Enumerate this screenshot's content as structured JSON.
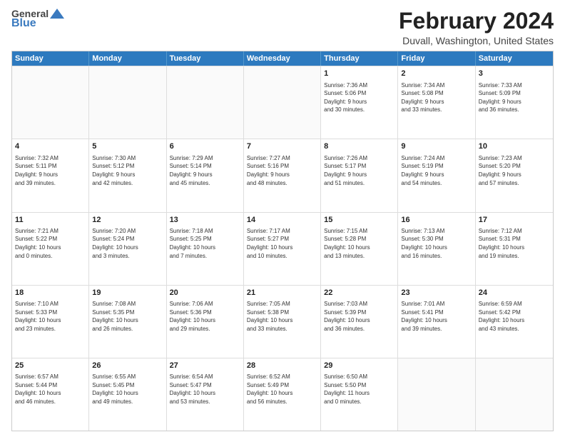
{
  "logo": {
    "general": "General",
    "blue": "Blue"
  },
  "title": "February 2024",
  "location": "Duvall, Washington, United States",
  "days": [
    "Sunday",
    "Monday",
    "Tuesday",
    "Wednesday",
    "Thursday",
    "Friday",
    "Saturday"
  ],
  "rows": [
    [
      {
        "day": "",
        "info": ""
      },
      {
        "day": "",
        "info": ""
      },
      {
        "day": "",
        "info": ""
      },
      {
        "day": "",
        "info": ""
      },
      {
        "day": "1",
        "info": "Sunrise: 7:36 AM\nSunset: 5:06 PM\nDaylight: 9 hours\nand 30 minutes."
      },
      {
        "day": "2",
        "info": "Sunrise: 7:34 AM\nSunset: 5:08 PM\nDaylight: 9 hours\nand 33 minutes."
      },
      {
        "day": "3",
        "info": "Sunrise: 7:33 AM\nSunset: 5:09 PM\nDaylight: 9 hours\nand 36 minutes."
      }
    ],
    [
      {
        "day": "4",
        "info": "Sunrise: 7:32 AM\nSunset: 5:11 PM\nDaylight: 9 hours\nand 39 minutes."
      },
      {
        "day": "5",
        "info": "Sunrise: 7:30 AM\nSunset: 5:12 PM\nDaylight: 9 hours\nand 42 minutes."
      },
      {
        "day": "6",
        "info": "Sunrise: 7:29 AM\nSunset: 5:14 PM\nDaylight: 9 hours\nand 45 minutes."
      },
      {
        "day": "7",
        "info": "Sunrise: 7:27 AM\nSunset: 5:16 PM\nDaylight: 9 hours\nand 48 minutes."
      },
      {
        "day": "8",
        "info": "Sunrise: 7:26 AM\nSunset: 5:17 PM\nDaylight: 9 hours\nand 51 minutes."
      },
      {
        "day": "9",
        "info": "Sunrise: 7:24 AM\nSunset: 5:19 PM\nDaylight: 9 hours\nand 54 minutes."
      },
      {
        "day": "10",
        "info": "Sunrise: 7:23 AM\nSunset: 5:20 PM\nDaylight: 9 hours\nand 57 minutes."
      }
    ],
    [
      {
        "day": "11",
        "info": "Sunrise: 7:21 AM\nSunset: 5:22 PM\nDaylight: 10 hours\nand 0 minutes."
      },
      {
        "day": "12",
        "info": "Sunrise: 7:20 AM\nSunset: 5:24 PM\nDaylight: 10 hours\nand 3 minutes."
      },
      {
        "day": "13",
        "info": "Sunrise: 7:18 AM\nSunset: 5:25 PM\nDaylight: 10 hours\nand 7 minutes."
      },
      {
        "day": "14",
        "info": "Sunrise: 7:17 AM\nSunset: 5:27 PM\nDaylight: 10 hours\nand 10 minutes."
      },
      {
        "day": "15",
        "info": "Sunrise: 7:15 AM\nSunset: 5:28 PM\nDaylight: 10 hours\nand 13 minutes."
      },
      {
        "day": "16",
        "info": "Sunrise: 7:13 AM\nSunset: 5:30 PM\nDaylight: 10 hours\nand 16 minutes."
      },
      {
        "day": "17",
        "info": "Sunrise: 7:12 AM\nSunset: 5:31 PM\nDaylight: 10 hours\nand 19 minutes."
      }
    ],
    [
      {
        "day": "18",
        "info": "Sunrise: 7:10 AM\nSunset: 5:33 PM\nDaylight: 10 hours\nand 23 minutes."
      },
      {
        "day": "19",
        "info": "Sunrise: 7:08 AM\nSunset: 5:35 PM\nDaylight: 10 hours\nand 26 minutes."
      },
      {
        "day": "20",
        "info": "Sunrise: 7:06 AM\nSunset: 5:36 PM\nDaylight: 10 hours\nand 29 minutes."
      },
      {
        "day": "21",
        "info": "Sunrise: 7:05 AM\nSunset: 5:38 PM\nDaylight: 10 hours\nand 33 minutes."
      },
      {
        "day": "22",
        "info": "Sunrise: 7:03 AM\nSunset: 5:39 PM\nDaylight: 10 hours\nand 36 minutes."
      },
      {
        "day": "23",
        "info": "Sunrise: 7:01 AM\nSunset: 5:41 PM\nDaylight: 10 hours\nand 39 minutes."
      },
      {
        "day": "24",
        "info": "Sunrise: 6:59 AM\nSunset: 5:42 PM\nDaylight: 10 hours\nand 43 minutes."
      }
    ],
    [
      {
        "day": "25",
        "info": "Sunrise: 6:57 AM\nSunset: 5:44 PM\nDaylight: 10 hours\nand 46 minutes."
      },
      {
        "day": "26",
        "info": "Sunrise: 6:55 AM\nSunset: 5:45 PM\nDaylight: 10 hours\nand 49 minutes."
      },
      {
        "day": "27",
        "info": "Sunrise: 6:54 AM\nSunset: 5:47 PM\nDaylight: 10 hours\nand 53 minutes."
      },
      {
        "day": "28",
        "info": "Sunrise: 6:52 AM\nSunset: 5:49 PM\nDaylight: 10 hours\nand 56 minutes."
      },
      {
        "day": "29",
        "info": "Sunrise: 6:50 AM\nSunset: 5:50 PM\nDaylight: 11 hours\nand 0 minutes."
      },
      {
        "day": "",
        "info": ""
      },
      {
        "day": "",
        "info": ""
      }
    ]
  ],
  "shading": [
    false,
    true,
    false,
    true,
    false
  ]
}
